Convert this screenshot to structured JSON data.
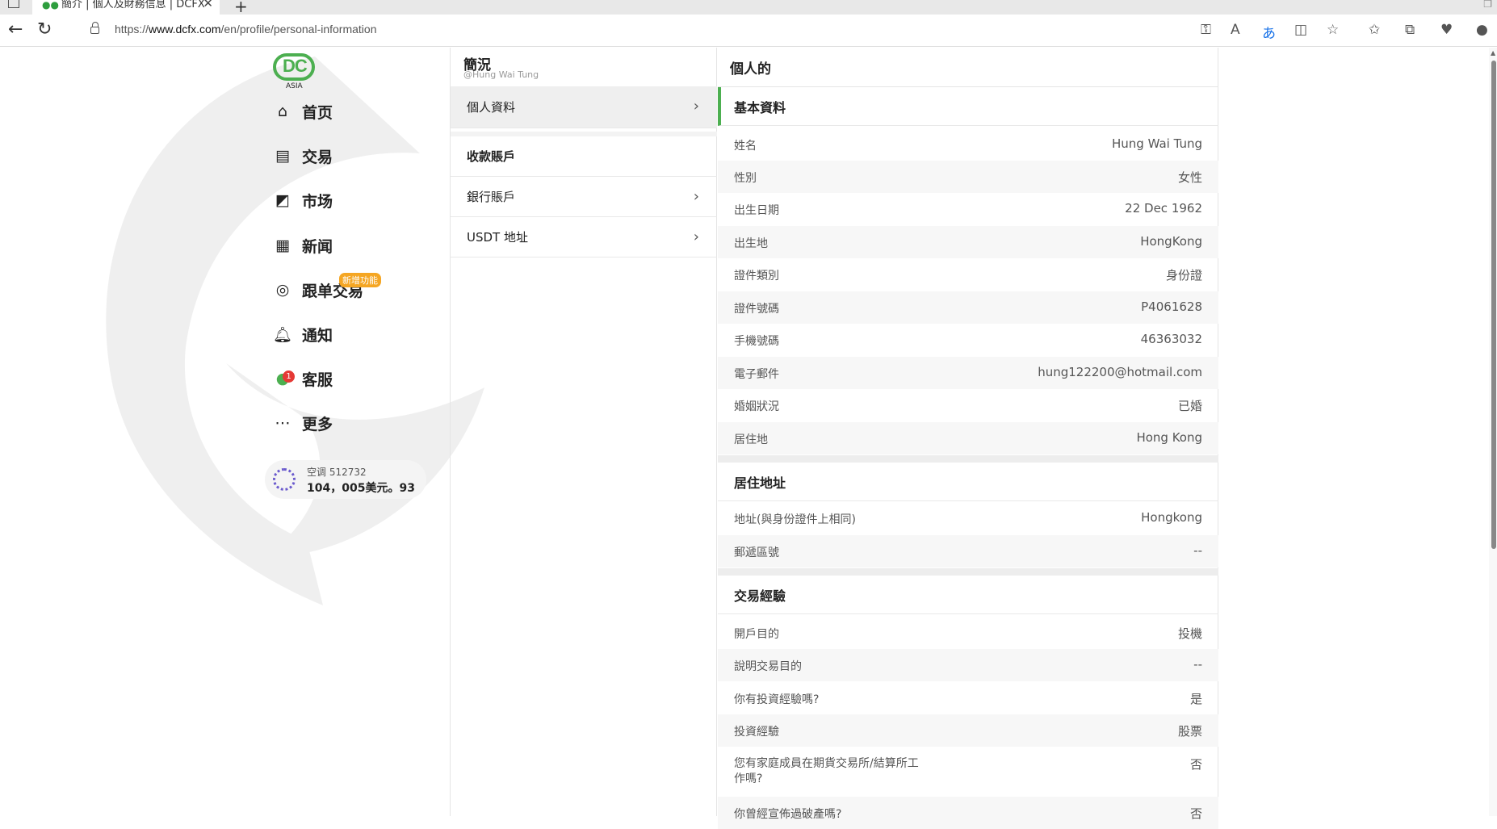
{
  "browser": {
    "tab_title": "簡介 | 個人及財務信息 | DCFX",
    "tab_close": "✕",
    "new_tab": "+",
    "url_prefix": "https://",
    "url_domain": "www.dcfx.com",
    "url_path": "/en/profile/personal-information"
  },
  "brand": {
    "logo_text": "DC",
    "logo_sub": "ASIA",
    "color": "#4caf50"
  },
  "sidebar": {
    "items": [
      {
        "label": "首页",
        "icon": "home-icon"
      },
      {
        "label": "交易",
        "icon": "trade-icon"
      },
      {
        "label": "市场",
        "icon": "market-chart-icon"
      },
      {
        "label": "新闻",
        "icon": "news-icon"
      },
      {
        "label": "跟单交易",
        "icon": "copy-trade-rss-icon",
        "badge": "新增功能"
      },
      {
        "label": "通知",
        "icon": "bell-icon"
      },
      {
        "label": "客服",
        "icon": "chat-bubble-icon",
        "badge_count": "1"
      },
      {
        "label": "更多",
        "icon": "more-dots-icon"
      }
    ],
    "account": {
      "name": "空调 512732",
      "balance": "104，005美元。93"
    }
  },
  "profile_nav": {
    "title": "簡況",
    "subtitle": "@Hung Wai Tung",
    "items": [
      {
        "label": "個人資料",
        "active": true,
        "chevron": true
      },
      {
        "label": "收款賬戶",
        "header": true
      },
      {
        "label": "銀行賬戶",
        "chevron": true
      },
      {
        "label": "USDT 地址",
        "chevron": true
      }
    ]
  },
  "details": {
    "title": "個人的",
    "sections": [
      {
        "heading": "基本資料",
        "fields": [
          {
            "key": "姓名",
            "value": "Hung Wai Tung"
          },
          {
            "key": "性別",
            "value": "女性"
          },
          {
            "key": "出生日期",
            "value": "22 Dec 1962"
          },
          {
            "key": "出生地",
            "value": "HongKong"
          },
          {
            "key": "證件類別",
            "value": "身份證"
          },
          {
            "key": "證件號碼",
            "value": "P4061628"
          },
          {
            "key": "手機號碼",
            "value": "46363032"
          },
          {
            "key": "電子郵件",
            "value": "hung122200@hotmail.com"
          },
          {
            "key": "婚姻狀況",
            "value": "已婚"
          },
          {
            "key": "居住地",
            "value": "Hong Kong"
          }
        ]
      },
      {
        "heading": "居住地址",
        "fields": [
          {
            "key": "地址(與身份證件上相同)",
            "value": "Hongkong"
          },
          {
            "key": "郵遞區號",
            "value": "--"
          }
        ]
      },
      {
        "heading": "交易經驗",
        "fields": [
          {
            "key": "開戶目的",
            "value": "投機"
          },
          {
            "key": "說明交易目的",
            "value": "--"
          },
          {
            "key": "你有投資經驗嗎?",
            "value": "是"
          },
          {
            "key": "投資經驗",
            "value": "股票"
          },
          {
            "key": "您有家庭成員在期貨交易所/結算所工作嗎?",
            "value": "否"
          },
          {
            "key": "你曾經宣佈過破產嗎?",
            "value": "否"
          }
        ]
      }
    ]
  }
}
